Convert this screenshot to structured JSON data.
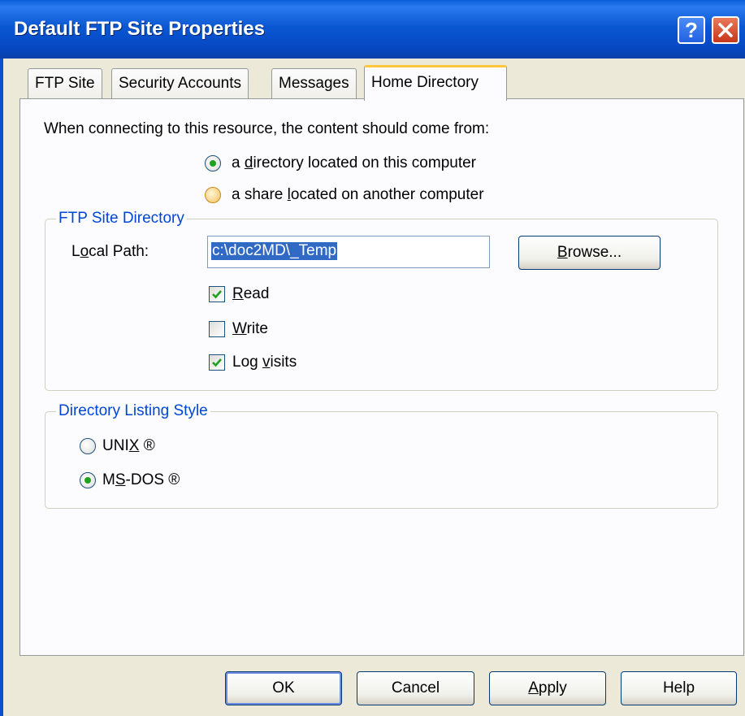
{
  "window": {
    "title": "Default FTP Site Properties",
    "help_label": "?"
  },
  "tabs": [
    {
      "label": "FTP Site"
    },
    {
      "label": "Security Accounts"
    },
    {
      "label": "Messages"
    },
    {
      "label": "Home Directory"
    }
  ],
  "content_source": {
    "prompt": "When connecting to this resource, the content should come from:",
    "option_directory": "a directory located on this computer",
    "option_share": "a share located on another computer",
    "selected": "a directory located on this computer"
  },
  "ftp_site_directory": {
    "title": "FTP Site Directory",
    "local_path_label": "Local Path:",
    "local_path_value": "c:\\doc2MD\\_Temp",
    "browse_label": "Browse...",
    "read_label": "Read",
    "read_checked": true,
    "write_label": "Write",
    "write_checked": false,
    "log_label": "Log visits",
    "log_checked": true
  },
  "listing_style": {
    "title": "Directory Listing Style",
    "unix_label": "UNIX ®",
    "msdos_label": "MS-DOS ®",
    "selected": "MS-DOS ®"
  },
  "buttons": {
    "ok": "OK",
    "cancel": "Cancel",
    "apply": "Apply",
    "help": "Help"
  },
  "colors": {
    "titlebar": "#0b58d2",
    "group_title": "#0046d5",
    "selection": "#316ac5",
    "active_tab_accent": "#ffc83c"
  },
  "icons": {
    "help": "question-mark-icon",
    "close": "close-x-icon"
  }
}
